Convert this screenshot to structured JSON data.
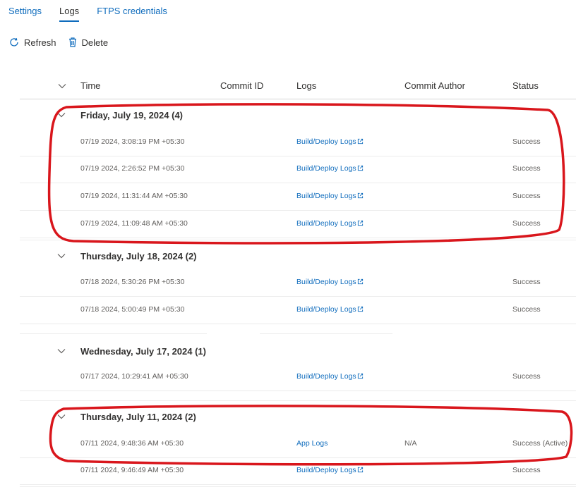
{
  "tabs": [
    "Settings",
    "Logs",
    "FTPS credentials"
  ],
  "toolbar": {
    "refresh": "Refresh",
    "delete": "Delete"
  },
  "columns": {
    "time": "Time",
    "commit_id": "Commit ID",
    "logs": "Logs",
    "commit_author": "Commit Author",
    "status": "Status"
  },
  "groups": [
    {
      "title": "Friday, July 19, 2024 (4)",
      "rows": [
        {
          "time": "07/19 2024, 3:08:19 PM +05:30",
          "log": "Build/Deploy Logs",
          "author": "",
          "status": "Success"
        },
        {
          "time": "07/19 2024, 2:26:52 PM +05:30",
          "log": "Build/Deploy Logs",
          "author": "",
          "status": "Success"
        },
        {
          "time": "07/19 2024, 11:31:44 AM +05:30",
          "log": "Build/Deploy Logs",
          "author": "",
          "status": "Success"
        },
        {
          "time": "07/19 2024, 11:09:48 AM +05:30",
          "log": "Build/Deploy Logs",
          "author": "",
          "status": "Success"
        }
      ]
    },
    {
      "title": "Thursday, July 18, 2024 (2)",
      "rows": [
        {
          "time": "07/18 2024, 5:30:26 PM +05:30",
          "log": "Build/Deploy Logs",
          "author": "",
          "status": "Success"
        },
        {
          "time": "07/18 2024, 5:00:49 PM +05:30",
          "log": "Build/Deploy Logs",
          "author": "",
          "status": "Success"
        }
      ]
    },
    {
      "title": "Wednesday, July 17, 2024 (1)",
      "rows": [
        {
          "time": "07/17 2024, 10:29:41 AM +05:30",
          "log": "Build/Deploy Logs",
          "author": "",
          "status": "Success"
        }
      ]
    },
    {
      "title": "Thursday, July 11, 2024 (2)",
      "rows": [
        {
          "time": "07/11 2024, 9:48:36 AM +05:30",
          "log": "App Logs",
          "author": "N/A",
          "status": "Success (Active)"
        },
        {
          "time": "07/11 2024, 9:46:49 AM +05:30",
          "log": "Build/Deploy Logs",
          "author": "",
          "status": "Success"
        }
      ]
    }
  ],
  "colors": {
    "accent": "#0f6cbd",
    "annotation": "#d9161c"
  },
  "icons": {
    "refresh": "refresh-icon",
    "delete": "trash-icon",
    "external": "external-link-icon",
    "chevron": "chevron-down-icon"
  }
}
